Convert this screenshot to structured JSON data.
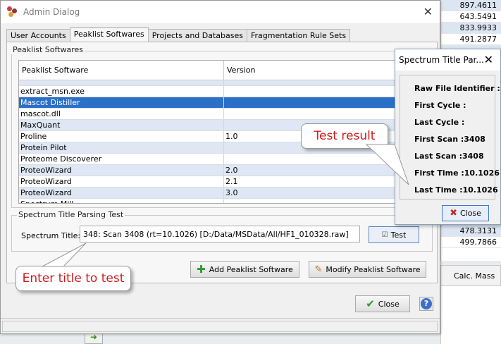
{
  "dialog": {
    "title": "Admin Dialog"
  },
  "tabs": [
    "User Accounts",
    "Peaklist Softwares",
    "Projects and Databases",
    "Fragmentation Rule Sets"
  ],
  "peaklist_group": {
    "title": "Peaklist Softwares",
    "columns": [
      "Peaklist Software",
      "Version"
    ],
    "rows": [
      {
        "name": "",
        "version": ""
      },
      {
        "name": "extract_msn.exe",
        "version": ""
      },
      {
        "name": "Mascot Distiller",
        "version": ""
      },
      {
        "name": "mascot.dll",
        "version": ""
      },
      {
        "name": "MaxQuant",
        "version": ""
      },
      {
        "name": "Proline",
        "version": "1.0"
      },
      {
        "name": "Protein Pilot",
        "version": ""
      },
      {
        "name": "Proteome Discoverer",
        "version": ""
      },
      {
        "name": "ProteoWizard",
        "version": "2.0"
      },
      {
        "name": "ProteoWizard",
        "version": "2.1"
      },
      {
        "name": "ProteoWizard",
        "version": "3.0"
      },
      {
        "name": "Spectrum Mill",
        "version": ""
      }
    ]
  },
  "parsing_test": {
    "title": "Spectrum Title Parsing Test",
    "label": "Spectrum Title:",
    "value": "348: Scan 3408 (rt=10.1026) [D:/Data/MSData/All/HF1_010328.raw]",
    "test_button": "Test"
  },
  "buttons": {
    "add": "Add Peaklist Software",
    "modify": "Modify Peaklist Software",
    "close": "Close",
    "help": "?"
  },
  "popup": {
    "title": "Spectrum Title Par...",
    "lines": [
      "Raw File Identifier :",
      "First Cycle :",
      "Last Cycle :",
      "First Scan :3408",
      "Last Scan :3408",
      "First Time :10.1026",
      "Last Time :10.1026"
    ],
    "close": "Close"
  },
  "callouts": {
    "test_result": "Test result",
    "enter_title": "Enter title to test"
  },
  "background": {
    "values": [
      "897.4611",
      "643.5491",
      "833.9933",
      "491.2877",
      "",
      "",
      "",
      "",
      "",
      "",
      "",
      "",
      "",
      "",
      "",
      "",
      "",
      "",
      "",
      "",
      "478.3131",
      "499.7866"
    ],
    "calc_mass_header": "Calc. Mass"
  },
  "colors": {
    "selection": "#2c6fc7",
    "alt_row": "#dee7f3",
    "callout_text": "#d01c1c"
  }
}
